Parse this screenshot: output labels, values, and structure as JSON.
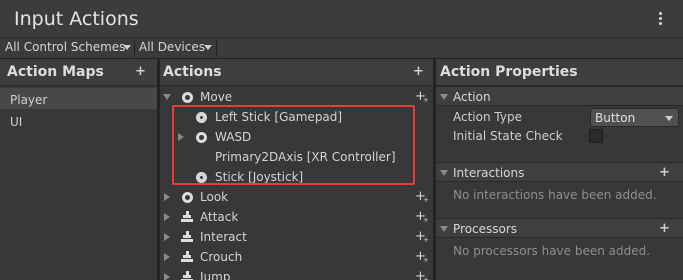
{
  "window": {
    "title": "Input Actions"
  },
  "toolbar": {
    "control_schemes": "All Control Schemes",
    "devices": "All Devices"
  },
  "action_maps": {
    "header": "Action Maps",
    "items": [
      {
        "label": "Player",
        "selected": true
      },
      {
        "label": "UI",
        "selected": false
      }
    ]
  },
  "actions": {
    "header": "Actions",
    "rows": [
      {
        "label": "Move",
        "icon": "radio-icon",
        "expanded": true
      },
      {
        "label": "Left Stick [Gamepad]",
        "icon": "dpad-icon"
      },
      {
        "label": "WASD",
        "icon": "radio-icon",
        "expanded": false
      },
      {
        "label": "Primary2DAxis [XR Controller]",
        "icon": ""
      },
      {
        "label": "Stick [Joystick]",
        "icon": "dpad-icon"
      },
      {
        "label": "Look",
        "icon": "radio-icon",
        "expanded": false
      },
      {
        "label": "Attack",
        "icon": "button-icon",
        "expanded": false
      },
      {
        "label": "Interact",
        "icon": "button-icon",
        "expanded": false
      },
      {
        "label": "Crouch",
        "icon": "button-icon",
        "expanded": false
      },
      {
        "label": "Jump",
        "icon": "button-icon",
        "expanded": false
      }
    ]
  },
  "properties": {
    "header": "Action Properties",
    "action_section": {
      "label": "Action",
      "action_type_label": "Action Type",
      "action_type_value": "Button",
      "initial_state_label": "Initial State Check"
    },
    "interactions": {
      "label": "Interactions",
      "empty": "No interactions have been added."
    },
    "processors": {
      "label": "Processors",
      "empty": "No processors have been added."
    }
  },
  "colors": {
    "highlight": "#e63c3c",
    "background": "#383838"
  }
}
